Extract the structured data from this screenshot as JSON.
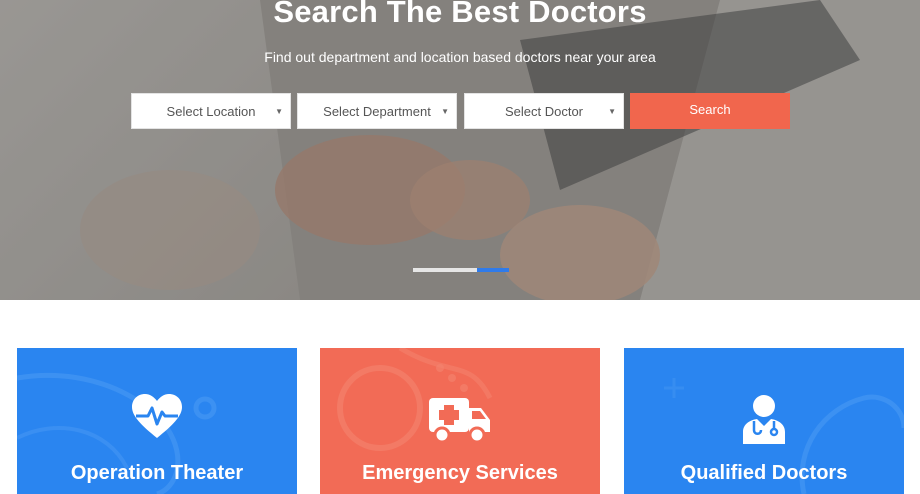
{
  "hero": {
    "title": "Search The Best Doctors",
    "subtitle": "Find out department and location based doctors near your area",
    "slider_active_index": 2,
    "slider_count": 2
  },
  "search": {
    "location": "Select Location",
    "department": "Select Department",
    "doctor": "Select Doctor",
    "button": "Search"
  },
  "features": [
    {
      "title": "Operation Theater",
      "icon": "heart-pulse-icon",
      "color": "#2a85f0"
    },
    {
      "title": "Emergency Services",
      "icon": "ambulance-icon",
      "color": "#f26b56"
    },
    {
      "title": "Qualified Doctors",
      "icon": "doctor-icon",
      "color": "#2a85f0"
    }
  ],
  "colors": {
    "accent": "#f1664d",
    "primary": "#2a85f0",
    "slider_active": "#2f7bea"
  }
}
